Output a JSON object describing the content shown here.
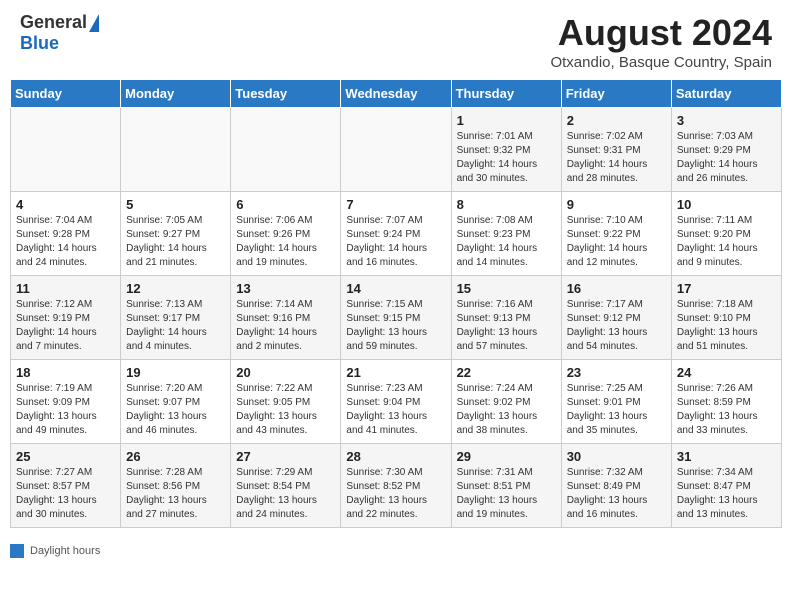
{
  "header": {
    "logo_general": "General",
    "logo_blue": "Blue",
    "month_title": "August 2024",
    "subtitle": "Otxandio, Basque Country, Spain"
  },
  "weekdays": [
    "Sunday",
    "Monday",
    "Tuesday",
    "Wednesday",
    "Thursday",
    "Friday",
    "Saturday"
  ],
  "weeks": [
    [
      {
        "day": "",
        "info": ""
      },
      {
        "day": "",
        "info": ""
      },
      {
        "day": "",
        "info": ""
      },
      {
        "day": "",
        "info": ""
      },
      {
        "day": "1",
        "info": "Sunrise: 7:01 AM\nSunset: 9:32 PM\nDaylight: 14 hours\nand 30 minutes."
      },
      {
        "day": "2",
        "info": "Sunrise: 7:02 AM\nSunset: 9:31 PM\nDaylight: 14 hours\nand 28 minutes."
      },
      {
        "day": "3",
        "info": "Sunrise: 7:03 AM\nSunset: 9:29 PM\nDaylight: 14 hours\nand 26 minutes."
      }
    ],
    [
      {
        "day": "4",
        "info": "Sunrise: 7:04 AM\nSunset: 9:28 PM\nDaylight: 14 hours\nand 24 minutes."
      },
      {
        "day": "5",
        "info": "Sunrise: 7:05 AM\nSunset: 9:27 PM\nDaylight: 14 hours\nand 21 minutes."
      },
      {
        "day": "6",
        "info": "Sunrise: 7:06 AM\nSunset: 9:26 PM\nDaylight: 14 hours\nand 19 minutes."
      },
      {
        "day": "7",
        "info": "Sunrise: 7:07 AM\nSunset: 9:24 PM\nDaylight: 14 hours\nand 16 minutes."
      },
      {
        "day": "8",
        "info": "Sunrise: 7:08 AM\nSunset: 9:23 PM\nDaylight: 14 hours\nand 14 minutes."
      },
      {
        "day": "9",
        "info": "Sunrise: 7:10 AM\nSunset: 9:22 PM\nDaylight: 14 hours\nand 12 minutes."
      },
      {
        "day": "10",
        "info": "Sunrise: 7:11 AM\nSunset: 9:20 PM\nDaylight: 14 hours\nand 9 minutes."
      }
    ],
    [
      {
        "day": "11",
        "info": "Sunrise: 7:12 AM\nSunset: 9:19 PM\nDaylight: 14 hours\nand 7 minutes."
      },
      {
        "day": "12",
        "info": "Sunrise: 7:13 AM\nSunset: 9:17 PM\nDaylight: 14 hours\nand 4 minutes."
      },
      {
        "day": "13",
        "info": "Sunrise: 7:14 AM\nSunset: 9:16 PM\nDaylight: 14 hours\nand 2 minutes."
      },
      {
        "day": "14",
        "info": "Sunrise: 7:15 AM\nSunset: 9:15 PM\nDaylight: 13 hours\nand 59 minutes."
      },
      {
        "day": "15",
        "info": "Sunrise: 7:16 AM\nSunset: 9:13 PM\nDaylight: 13 hours\nand 57 minutes."
      },
      {
        "day": "16",
        "info": "Sunrise: 7:17 AM\nSunset: 9:12 PM\nDaylight: 13 hours\nand 54 minutes."
      },
      {
        "day": "17",
        "info": "Sunrise: 7:18 AM\nSunset: 9:10 PM\nDaylight: 13 hours\nand 51 minutes."
      }
    ],
    [
      {
        "day": "18",
        "info": "Sunrise: 7:19 AM\nSunset: 9:09 PM\nDaylight: 13 hours\nand 49 minutes."
      },
      {
        "day": "19",
        "info": "Sunrise: 7:20 AM\nSunset: 9:07 PM\nDaylight: 13 hours\nand 46 minutes."
      },
      {
        "day": "20",
        "info": "Sunrise: 7:22 AM\nSunset: 9:05 PM\nDaylight: 13 hours\nand 43 minutes."
      },
      {
        "day": "21",
        "info": "Sunrise: 7:23 AM\nSunset: 9:04 PM\nDaylight: 13 hours\nand 41 minutes."
      },
      {
        "day": "22",
        "info": "Sunrise: 7:24 AM\nSunset: 9:02 PM\nDaylight: 13 hours\nand 38 minutes."
      },
      {
        "day": "23",
        "info": "Sunrise: 7:25 AM\nSunset: 9:01 PM\nDaylight: 13 hours\nand 35 minutes."
      },
      {
        "day": "24",
        "info": "Sunrise: 7:26 AM\nSunset: 8:59 PM\nDaylight: 13 hours\nand 33 minutes."
      }
    ],
    [
      {
        "day": "25",
        "info": "Sunrise: 7:27 AM\nSunset: 8:57 PM\nDaylight: 13 hours\nand 30 minutes."
      },
      {
        "day": "26",
        "info": "Sunrise: 7:28 AM\nSunset: 8:56 PM\nDaylight: 13 hours\nand 27 minutes."
      },
      {
        "day": "27",
        "info": "Sunrise: 7:29 AM\nSunset: 8:54 PM\nDaylight: 13 hours\nand 24 minutes."
      },
      {
        "day": "28",
        "info": "Sunrise: 7:30 AM\nSunset: 8:52 PM\nDaylight: 13 hours\nand 22 minutes."
      },
      {
        "day": "29",
        "info": "Sunrise: 7:31 AM\nSunset: 8:51 PM\nDaylight: 13 hours\nand 19 minutes."
      },
      {
        "day": "30",
        "info": "Sunrise: 7:32 AM\nSunset: 8:49 PM\nDaylight: 13 hours\nand 16 minutes."
      },
      {
        "day": "31",
        "info": "Sunrise: 7:34 AM\nSunset: 8:47 PM\nDaylight: 13 hours\nand 13 minutes."
      }
    ]
  ],
  "legend": {
    "label": "Daylight hours"
  }
}
